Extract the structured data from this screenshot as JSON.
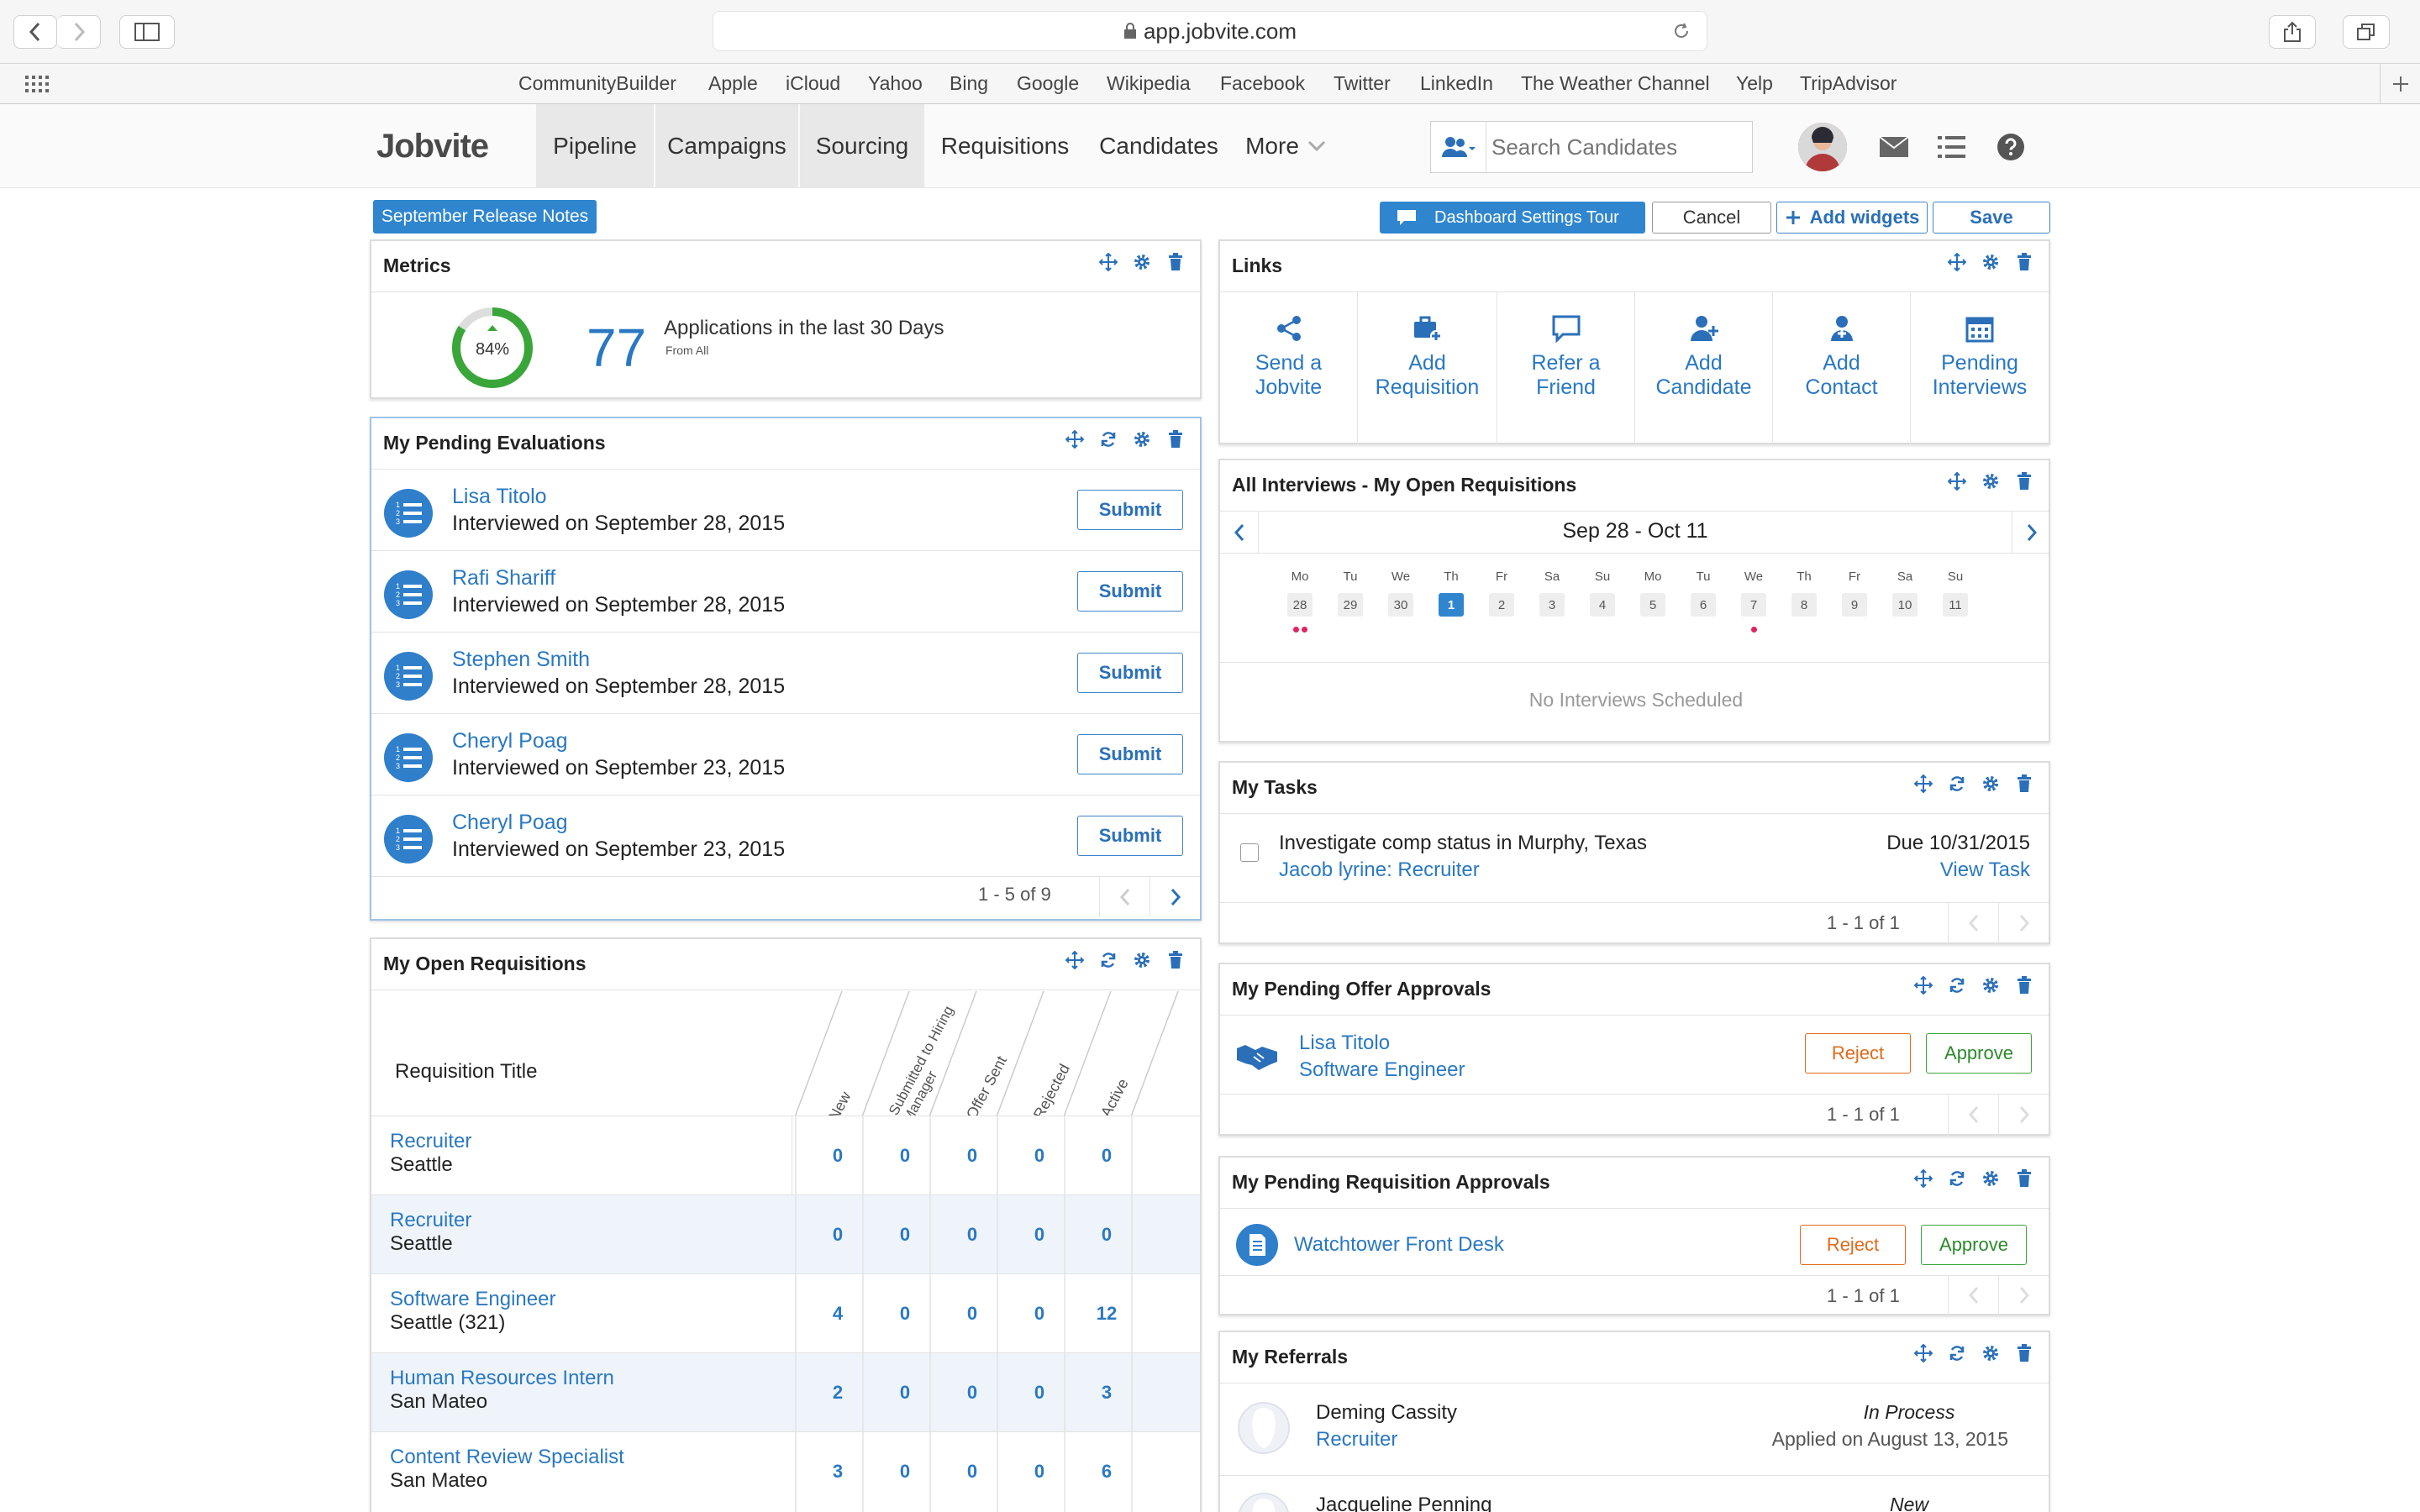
{
  "browser": {
    "url": "app.jobvite.com",
    "bookmarks": [
      "CommunityBuilder",
      "Apple",
      "iCloud",
      "Yahoo",
      "Bing",
      "Google",
      "Wikipedia",
      "Facebook",
      "Twitter",
      "LinkedIn",
      "The Weather Channel",
      "Yelp",
      "TripAdvisor"
    ]
  },
  "app": {
    "logo": "Jobvite",
    "nav": [
      "Pipeline",
      "Campaigns",
      "Sourcing",
      "Requisitions",
      "Candidates",
      "More"
    ],
    "search_placeholder": "Search Candidates"
  },
  "toolbar": {
    "release_notes": "September Release Notes",
    "tour": "Dashboard Settings Tour",
    "cancel": "Cancel",
    "add_widgets": "Add widgets",
    "save": "Save"
  },
  "metrics": {
    "title": "Metrics",
    "percent": "84%",
    "percent_value": 0.84,
    "count": "77",
    "label": "Applications in the last 30 Days",
    "sub": "From All"
  },
  "evaluations": {
    "title": "My Pending Evaluations",
    "items": [
      {
        "name": "Lisa Titolo",
        "detail": "Interviewed on September 28, 2015"
      },
      {
        "name": "Rafi Shariff",
        "detail": "Interviewed on September 28, 2015"
      },
      {
        "name": "Stephen Smith",
        "detail": "Interviewed on September 28, 2015"
      },
      {
        "name": "Cheryl Poag",
        "detail": "Interviewed on September 23, 2015"
      },
      {
        "name": "Cheryl Poag",
        "detail": "Interviewed on September 23, 2015"
      }
    ],
    "submit": "Submit",
    "pager": "1 - 5 of 9"
  },
  "requisitions": {
    "title": "My Open Requisitions",
    "col_title": "Requisition Title",
    "columns": [
      "New",
      "Submitted to Hiring Manager",
      "Offer Sent",
      "Rejected",
      "Active"
    ],
    "rows": [
      {
        "title": "Recruiter",
        "loc": "Seattle",
        "vals": [
          "0",
          "0",
          "0",
          "0",
          "0"
        ]
      },
      {
        "title": "Recruiter",
        "loc": "Seattle",
        "vals": [
          "0",
          "0",
          "0",
          "0",
          "0"
        ]
      },
      {
        "title": "Software Engineer",
        "loc": "Seattle (321)",
        "vals": [
          "4",
          "0",
          "0",
          "0",
          "12"
        ]
      },
      {
        "title": "Human Resources Intern",
        "loc": "San Mateo",
        "vals": [
          "2",
          "0",
          "0",
          "0",
          "3"
        ]
      },
      {
        "title": "Content Review Specialist",
        "loc": "San Mateo",
        "vals": [
          "3",
          "0",
          "0",
          "0",
          "6"
        ]
      }
    ]
  },
  "links": {
    "title": "Links",
    "items": [
      {
        "l1": "Send a",
        "l2": "Jobvite",
        "icon": "share-icon"
      },
      {
        "l1": "Add",
        "l2": "Requisition",
        "icon": "briefcase-plus-icon"
      },
      {
        "l1": "Refer a",
        "l2": "Friend",
        "icon": "chat-icon"
      },
      {
        "l1": "Add",
        "l2": "Candidate",
        "icon": "user-plus-icon"
      },
      {
        "l1": "Add",
        "l2": "Contact",
        "icon": "contact-plus-icon"
      },
      {
        "l1": "Pending",
        "l2": "Interviews",
        "icon": "calendar-icon"
      }
    ]
  },
  "interviews": {
    "title": "All Interviews - My Open Requisitions",
    "range": "Sep 28 - Oct 11",
    "days": [
      "Mo",
      "Tu",
      "We",
      "Th",
      "Fr",
      "Sa",
      "Su",
      "Mo",
      "Tu",
      "We",
      "Th",
      "Fr",
      "Sa",
      "Su"
    ],
    "dates": [
      "28",
      "29",
      "30",
      "1",
      "2",
      "3",
      "4",
      "5",
      "6",
      "7",
      "8",
      "9",
      "10",
      "11"
    ],
    "selected_index": 3,
    "empty": "No Interviews Scheduled"
  },
  "tasks": {
    "title": "My Tasks",
    "task": "Investigate comp status in Murphy, Texas",
    "due": "Due 10/31/2015",
    "person": "Jacob lyrine: Recruiter",
    "view": "View Task",
    "pager": "1 - 1 of 1"
  },
  "offers": {
    "title": "My Pending Offer Approvals",
    "name": "Lisa Titolo",
    "role": "Software Engineer",
    "reject": "Reject",
    "approve": "Approve",
    "pager": "1 - 1 of 1"
  },
  "req_approvals": {
    "title": "My Pending Requisition Approvals",
    "name": "Watchtower Front Desk",
    "reject": "Reject",
    "approve": "Approve",
    "pager": "1 - 1 of 1"
  },
  "referrals": {
    "title": "My Referrals",
    "items": [
      {
        "name": "Deming Cassity",
        "role": "Recruiter",
        "status": "In Process",
        "applied": "Applied on August 13, 2015"
      },
      {
        "name": "Jacqueline Penning",
        "status": "New"
      }
    ]
  },
  "colors": {
    "accent": "#2f86cf",
    "link": "#2a78c2",
    "green": "#3aa63a",
    "reject": "#e06a1b",
    "approve": "#3aa63a",
    "dot": "#e0245e"
  }
}
